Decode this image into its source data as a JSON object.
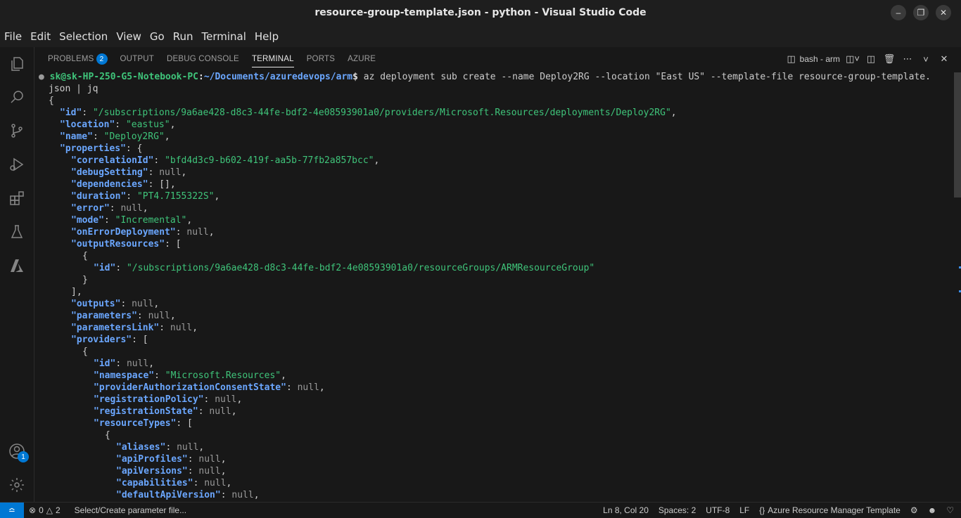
{
  "window": {
    "title": "resource-group-template.json - python - Visual Studio Code"
  },
  "menu": [
    "File",
    "Edit",
    "Selection",
    "View",
    "Go",
    "Run",
    "Terminal",
    "Help"
  ],
  "panel": {
    "tabs": [
      {
        "label": "PROBLEMS",
        "badge": "2"
      },
      {
        "label": "OUTPUT"
      },
      {
        "label": "DEBUG CONSOLE"
      },
      {
        "label": "TERMINAL",
        "active": true
      },
      {
        "label": "PORTS"
      },
      {
        "label": "AZURE"
      }
    ],
    "terminal_name": "bash - arm"
  },
  "accounts_badge": "1",
  "terminal": {
    "prompt_user": "sk@sk-HP-250-G5-Notebook-PC",
    "prompt_path": "~/Documents/azuredevops/arm",
    "command": "az deployment sub create --name Deploy2RG --location \"East US\" --template-file resource-group-template.",
    "command_cont": "json | jq",
    "lines": [
      {
        "i": 0,
        "t": [
          [
            "p",
            "{"
          ]
        ]
      },
      {
        "i": 1,
        "t": [
          [
            "k",
            "\"id\""
          ],
          [
            "p",
            ": "
          ],
          [
            "s",
            "\"/subscriptions/9a6ae428-d8c3-44fe-bdf2-4e08593901a0/providers/Microsoft.Resources/deployments/Deploy2RG\""
          ],
          [
            "p",
            ","
          ]
        ]
      },
      {
        "i": 1,
        "t": [
          [
            "k",
            "\"location\""
          ],
          [
            "p",
            ": "
          ],
          [
            "s",
            "\"eastus\""
          ],
          [
            "p",
            ","
          ]
        ]
      },
      {
        "i": 1,
        "t": [
          [
            "k",
            "\"name\""
          ],
          [
            "p",
            ": "
          ],
          [
            "s",
            "\"Deploy2RG\""
          ],
          [
            "p",
            ","
          ]
        ]
      },
      {
        "i": 1,
        "t": [
          [
            "k",
            "\"properties\""
          ],
          [
            "p",
            ": {"
          ]
        ]
      },
      {
        "i": 2,
        "t": [
          [
            "k",
            "\"correlationId\""
          ],
          [
            "p",
            ": "
          ],
          [
            "s",
            "\"bfd4d3c9-b602-419f-aa5b-77fb2a857bcc\""
          ],
          [
            "p",
            ","
          ]
        ]
      },
      {
        "i": 2,
        "t": [
          [
            "k",
            "\"debugSetting\""
          ],
          [
            "p",
            ": "
          ],
          [
            "n",
            "null"
          ],
          [
            "p",
            ","
          ]
        ]
      },
      {
        "i": 2,
        "t": [
          [
            "k",
            "\"dependencies\""
          ],
          [
            "p",
            ": [],"
          ]
        ]
      },
      {
        "i": 2,
        "t": [
          [
            "k",
            "\"duration\""
          ],
          [
            "p",
            ": "
          ],
          [
            "s",
            "\"PT4.7155322S\""
          ],
          [
            "p",
            ","
          ]
        ]
      },
      {
        "i": 2,
        "t": [
          [
            "k",
            "\"error\""
          ],
          [
            "p",
            ": "
          ],
          [
            "n",
            "null"
          ],
          [
            "p",
            ","
          ]
        ]
      },
      {
        "i": 2,
        "t": [
          [
            "k",
            "\"mode\""
          ],
          [
            "p",
            ": "
          ],
          [
            "s",
            "\"Incremental\""
          ],
          [
            "p",
            ","
          ]
        ]
      },
      {
        "i": 2,
        "t": [
          [
            "k",
            "\"onErrorDeployment\""
          ],
          [
            "p",
            ": "
          ],
          [
            "n",
            "null"
          ],
          [
            "p",
            ","
          ]
        ]
      },
      {
        "i": 2,
        "t": [
          [
            "k",
            "\"outputResources\""
          ],
          [
            "p",
            ": ["
          ]
        ]
      },
      {
        "i": 3,
        "t": [
          [
            "p",
            "{"
          ]
        ]
      },
      {
        "i": 4,
        "t": [
          [
            "k",
            "\"id\""
          ],
          [
            "p",
            ": "
          ],
          [
            "s",
            "\"/subscriptions/9a6ae428-d8c3-44fe-bdf2-4e08593901a0/resourceGroups/ARMResourceGroup\""
          ]
        ]
      },
      {
        "i": 3,
        "t": [
          [
            "p",
            "}"
          ]
        ]
      },
      {
        "i": 2,
        "t": [
          [
            "p",
            "],"
          ]
        ]
      },
      {
        "i": 2,
        "t": [
          [
            "k",
            "\"outputs\""
          ],
          [
            "p",
            ": "
          ],
          [
            "n",
            "null"
          ],
          [
            "p",
            ","
          ]
        ]
      },
      {
        "i": 2,
        "t": [
          [
            "k",
            "\"parameters\""
          ],
          [
            "p",
            ": "
          ],
          [
            "n",
            "null"
          ],
          [
            "p",
            ","
          ]
        ]
      },
      {
        "i": 2,
        "t": [
          [
            "k",
            "\"parametersLink\""
          ],
          [
            "p",
            ": "
          ],
          [
            "n",
            "null"
          ],
          [
            "p",
            ","
          ]
        ]
      },
      {
        "i": 2,
        "t": [
          [
            "k",
            "\"providers\""
          ],
          [
            "p",
            ": ["
          ]
        ]
      },
      {
        "i": 3,
        "t": [
          [
            "p",
            "{"
          ]
        ]
      },
      {
        "i": 4,
        "t": [
          [
            "k",
            "\"id\""
          ],
          [
            "p",
            ": "
          ],
          [
            "n",
            "null"
          ],
          [
            "p",
            ","
          ]
        ]
      },
      {
        "i": 4,
        "t": [
          [
            "k",
            "\"namespace\""
          ],
          [
            "p",
            ": "
          ],
          [
            "s",
            "\"Microsoft.Resources\""
          ],
          [
            "p",
            ","
          ]
        ]
      },
      {
        "i": 4,
        "t": [
          [
            "k",
            "\"providerAuthorizationConsentState\""
          ],
          [
            "p",
            ": "
          ],
          [
            "n",
            "null"
          ],
          [
            "p",
            ","
          ]
        ]
      },
      {
        "i": 4,
        "t": [
          [
            "k",
            "\"registrationPolicy\""
          ],
          [
            "p",
            ": "
          ],
          [
            "n",
            "null"
          ],
          [
            "p",
            ","
          ]
        ]
      },
      {
        "i": 4,
        "t": [
          [
            "k",
            "\"registrationState\""
          ],
          [
            "p",
            ": "
          ],
          [
            "n",
            "null"
          ],
          [
            "p",
            ","
          ]
        ]
      },
      {
        "i": 4,
        "t": [
          [
            "k",
            "\"resourceTypes\""
          ],
          [
            "p",
            ": ["
          ]
        ]
      },
      {
        "i": 5,
        "t": [
          [
            "p",
            "{"
          ]
        ]
      },
      {
        "i": 6,
        "t": [
          [
            "k",
            "\"aliases\""
          ],
          [
            "p",
            ": "
          ],
          [
            "n",
            "null"
          ],
          [
            "p",
            ","
          ]
        ]
      },
      {
        "i": 6,
        "t": [
          [
            "k",
            "\"apiProfiles\""
          ],
          [
            "p",
            ": "
          ],
          [
            "n",
            "null"
          ],
          [
            "p",
            ","
          ]
        ]
      },
      {
        "i": 6,
        "t": [
          [
            "k",
            "\"apiVersions\""
          ],
          [
            "p",
            ": "
          ],
          [
            "n",
            "null"
          ],
          [
            "p",
            ","
          ]
        ]
      },
      {
        "i": 6,
        "t": [
          [
            "k",
            "\"capabilities\""
          ],
          [
            "p",
            ": "
          ],
          [
            "n",
            "null"
          ],
          [
            "p",
            ","
          ]
        ]
      },
      {
        "i": 6,
        "t": [
          [
            "k",
            "\"defaultApiVersion\""
          ],
          [
            "p",
            ": "
          ],
          [
            "n",
            "null"
          ],
          [
            "p",
            ","
          ]
        ]
      }
    ]
  },
  "status": {
    "errors": "0",
    "warnings": "2",
    "message": "Select/Create parameter file...",
    "position": "Ln 8, Col 20",
    "spaces": "Spaces: 2",
    "encoding": "UTF-8",
    "eol": "LF",
    "language": "Azure Resource Manager Template"
  }
}
